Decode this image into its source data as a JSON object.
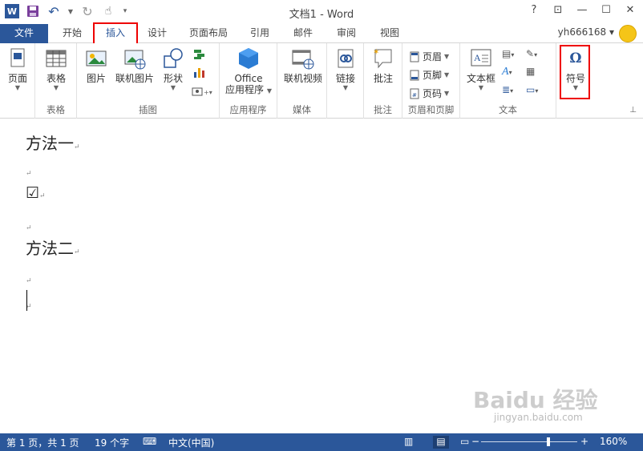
{
  "window": {
    "title": "文档1 - Word",
    "help": "?",
    "restore_ribbon": "⊡",
    "minimize": "—",
    "maximize": "☐",
    "close": "✕"
  },
  "tabs": {
    "file": "文件",
    "home": "开始",
    "insert": "插入",
    "design": "设计",
    "layout": "页面布局",
    "references": "引用",
    "mailings": "邮件",
    "review": "审阅",
    "view": "视图"
  },
  "user": "yh666168 ▾",
  "ribbon": {
    "pages": {
      "button": "页面",
      "label": ""
    },
    "tables": {
      "button": "表格",
      "label": "表格"
    },
    "illustrations": {
      "picture": "图片",
      "online_picture": "联机图片",
      "shapes": "形状",
      "label": "插图"
    },
    "apps": {
      "button_line1": "Office",
      "button_line2": "应用程序",
      "label": "应用程序"
    },
    "media": {
      "button": "联机视频",
      "label": "媒体"
    },
    "links": {
      "button": "链接",
      "label": ""
    },
    "comments": {
      "button": "批注",
      "label": "批注"
    },
    "header_footer": {
      "header": "页眉",
      "footer": "页脚",
      "page_number": "页码",
      "label": "页眉和页脚"
    },
    "text": {
      "textbox": "文本框",
      "label": "文本"
    },
    "symbols": {
      "button": "符号",
      "glyph": "Ω",
      "label": ""
    }
  },
  "document": {
    "line1": "方法一",
    "line3_symbol": "☑",
    "line5": "方法二",
    "para_mark": "↵"
  },
  "status": {
    "page": "第 1 页，共 1 页",
    "words": "19 个字",
    "language": "中文(中国)",
    "zoom_minus": "−",
    "zoom_plus": "+",
    "zoom": "160%",
    "zoom_fraction": 0.7
  },
  "watermark": {
    "main": "Baidu 经验",
    "sub": "jingyan.baidu.com"
  },
  "colors": {
    "word_blue": "#2b579a",
    "highlight_red": "#e00000"
  }
}
